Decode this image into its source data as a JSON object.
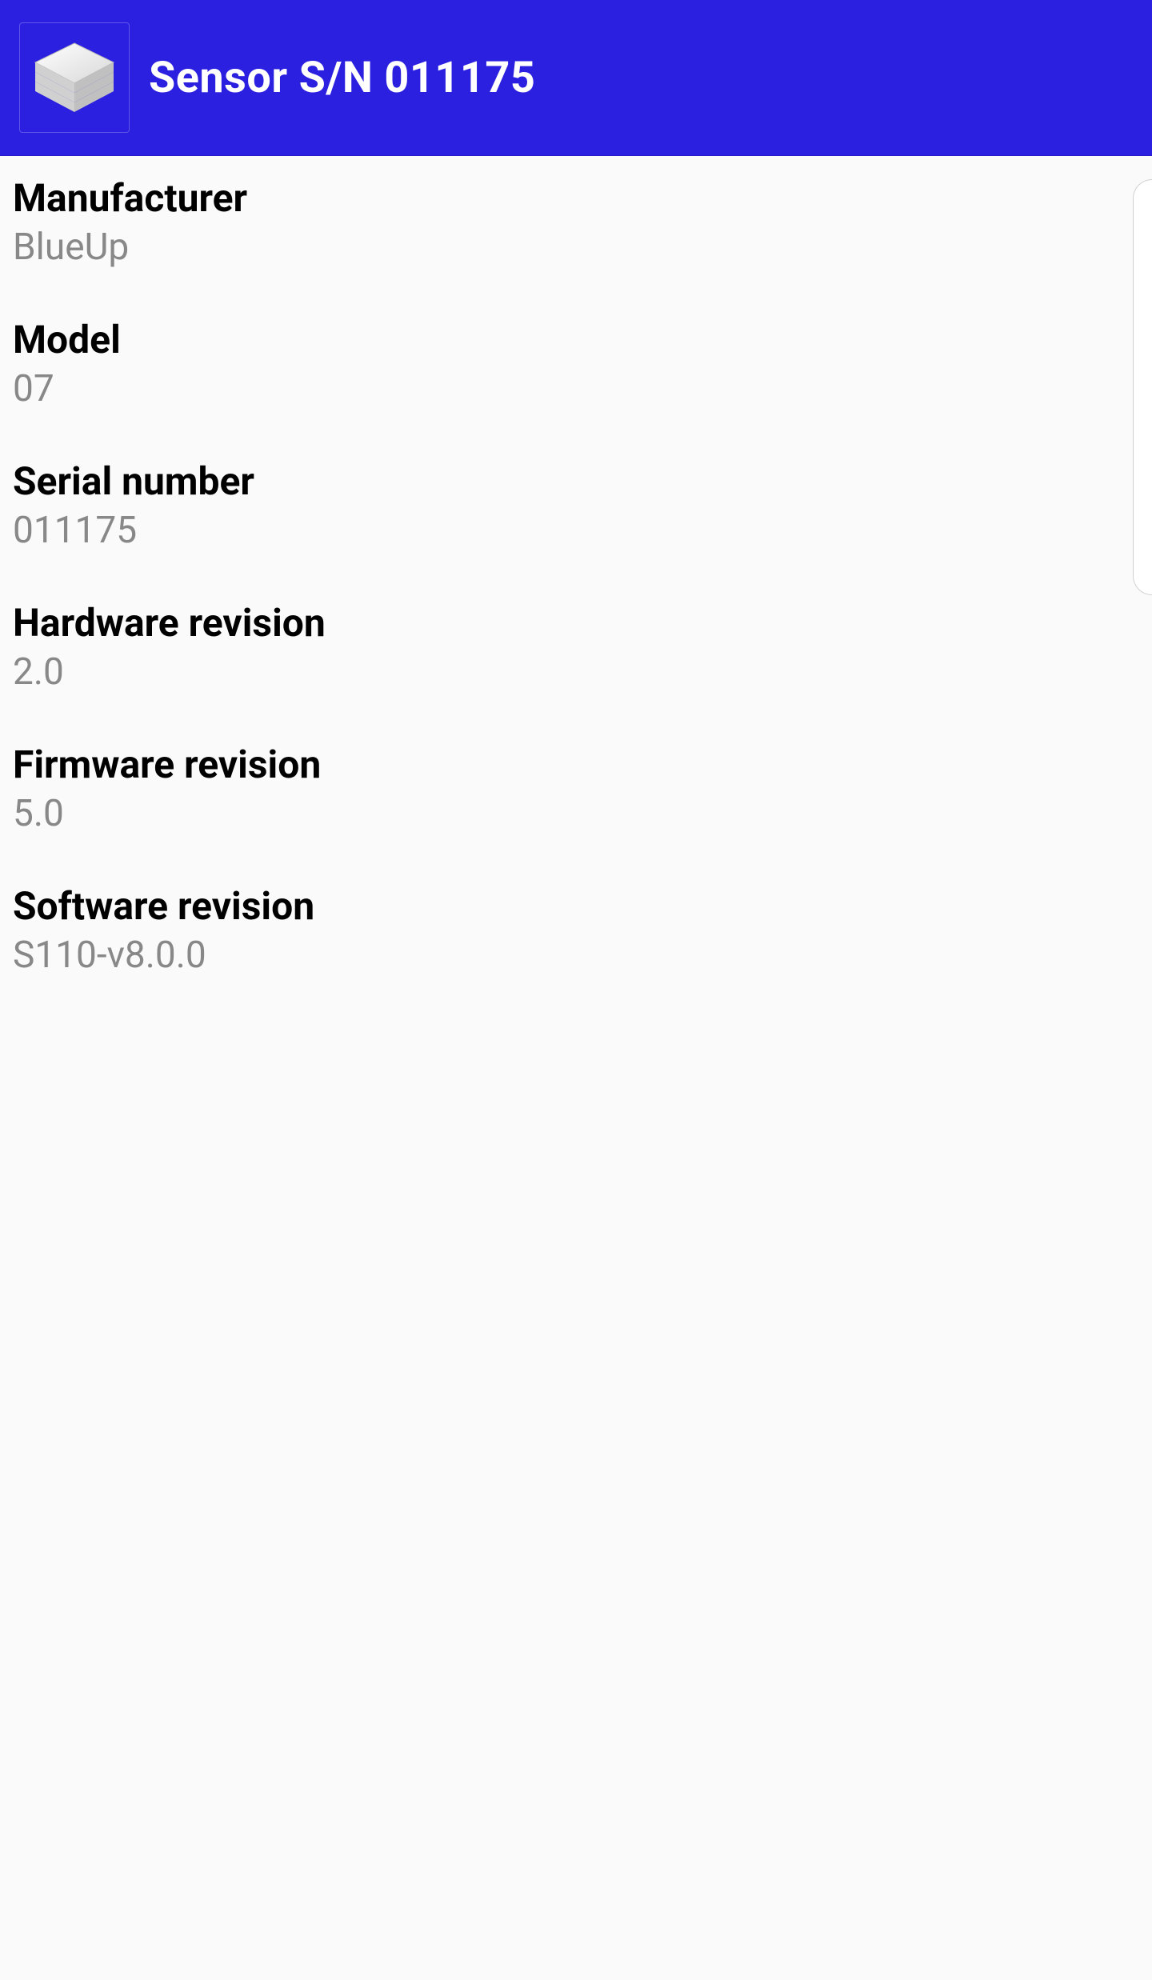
{
  "header": {
    "title": "Sensor S/N 011175"
  },
  "items": [
    {
      "label": "Manufacturer",
      "value": "BlueUp"
    },
    {
      "label": "Model",
      "value": "07"
    },
    {
      "label": "Serial number",
      "value": "011175"
    },
    {
      "label": "Hardware revision",
      "value": "2.0"
    },
    {
      "label": "Firmware revision",
      "value": "5.0"
    },
    {
      "label": "Software revision",
      "value": "S110-v8.0.0"
    }
  ]
}
